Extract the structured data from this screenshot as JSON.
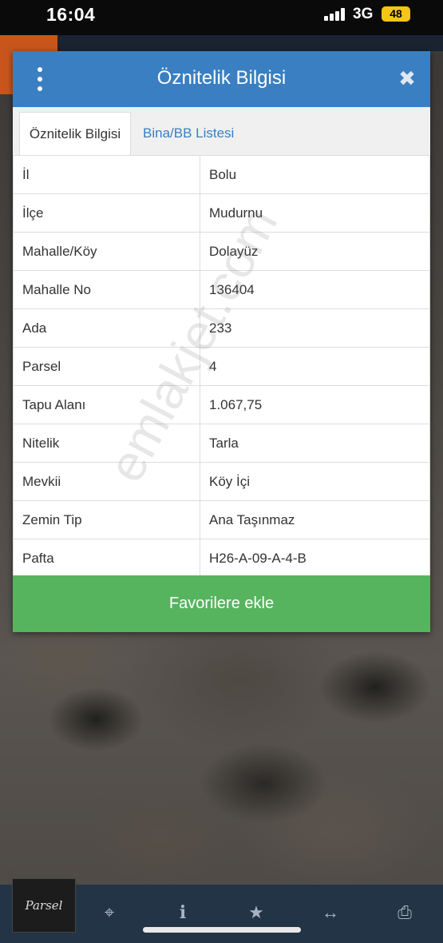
{
  "status_bar": {
    "time": "16:04",
    "network": "3G",
    "battery": "48"
  },
  "dialog": {
    "title": "Öznitelik Bilgisi",
    "close_icon": "close-icon",
    "menu_icon": "vertical-dots-icon"
  },
  "tabs": [
    {
      "label": "Öznitelik Bilgisi",
      "active": true
    },
    {
      "label": "Bina/BB Listesi",
      "active": false
    }
  ],
  "attributes": [
    {
      "key": "İl",
      "value": "Bolu"
    },
    {
      "key": "İlçe",
      "value": "Mudurnu"
    },
    {
      "key": "Mahalle/Köy",
      "value": "Dolayüz"
    },
    {
      "key": "Mahalle No",
      "value": "136404"
    },
    {
      "key": "Ada",
      "value": "233"
    },
    {
      "key": "Parsel",
      "value": "4"
    },
    {
      "key": "Tapu Alanı",
      "value": "1.067,75"
    },
    {
      "key": "Nitelik",
      "value": "Tarla"
    },
    {
      "key": "Mevkii",
      "value": "Köy İçi"
    },
    {
      "key": "Zemin Tip",
      "value": "Ana Taşınmaz"
    },
    {
      "key": "Pafta",
      "value": "H26-A-09-A-4-B"
    }
  ],
  "favorite_button": "Favorilere ekle",
  "watermark": "emlakjet.com",
  "logo_text": "Parsel",
  "toolbar": [
    {
      "icon": "locate-icon",
      "glyph": "⌖"
    },
    {
      "icon": "info-icon",
      "glyph": "i"
    },
    {
      "icon": "star-icon",
      "glyph": "★"
    },
    {
      "icon": "measure-icon",
      "glyph": "↔"
    },
    {
      "icon": "print-icon",
      "glyph": "⎙"
    }
  ],
  "colors": {
    "header": "#3a7fc1",
    "favorite": "#56b45f",
    "toolbar": "#243447"
  }
}
